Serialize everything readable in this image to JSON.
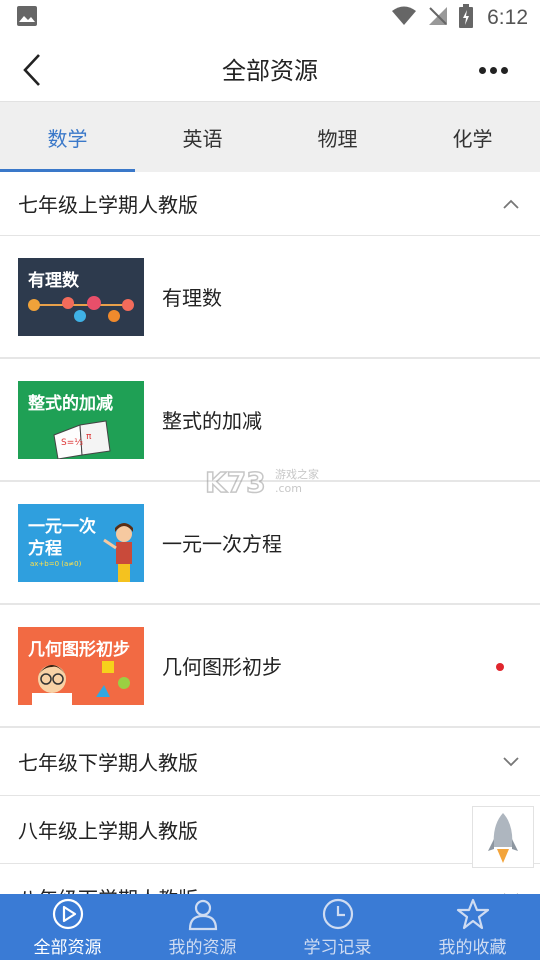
{
  "status_bar": {
    "time": "6:12"
  },
  "header": {
    "title": "全部资源"
  },
  "tabs": [
    {
      "label": "数学",
      "active": true
    },
    {
      "label": "英语",
      "active": false
    },
    {
      "label": "物理",
      "active": false
    },
    {
      "label": "化学",
      "active": false
    }
  ],
  "groups": [
    {
      "label": "七年级上学期人教版",
      "expanded": true
    },
    {
      "label": "七年级下学期人教版",
      "expanded": false
    },
    {
      "label": "八年级上学期人教版",
      "expanded": false
    },
    {
      "label": "八年级下学期人教版",
      "expanded": false
    }
  ],
  "items": [
    {
      "label": "有理数",
      "thumb_title": "有理数",
      "thumb_color": "#2d3a4d"
    },
    {
      "label": "整式的加减",
      "thumb_title": "整式的加减",
      "thumb_color": "#1fa055"
    },
    {
      "label": "一元一次方程",
      "thumb_title": "一元一次",
      "thumb_subtitle": "方程",
      "thumb_formula": "ax+b=0 (a≠0)",
      "thumb_color": "#2f9fde"
    },
    {
      "label": "几何图形初步",
      "thumb_title": "几何图形初步",
      "thumb_color": "#f26a43",
      "unread": true
    }
  ],
  "watermark": {
    "text": "K73",
    "sub": "游戏之家",
    "domain": ".com"
  },
  "bottom_nav": [
    {
      "label": "全部资源",
      "icon": "play-circle-icon",
      "active": true
    },
    {
      "label": "我的资源",
      "icon": "user-icon",
      "active": false
    },
    {
      "label": "学习记录",
      "icon": "clock-icon",
      "active": false
    },
    {
      "label": "我的收藏",
      "icon": "star-icon",
      "active": false
    }
  ],
  "colors": {
    "accent": "#3a78c9",
    "nav_bg": "#3a7bd5",
    "unread_dot": "#e0262d"
  }
}
